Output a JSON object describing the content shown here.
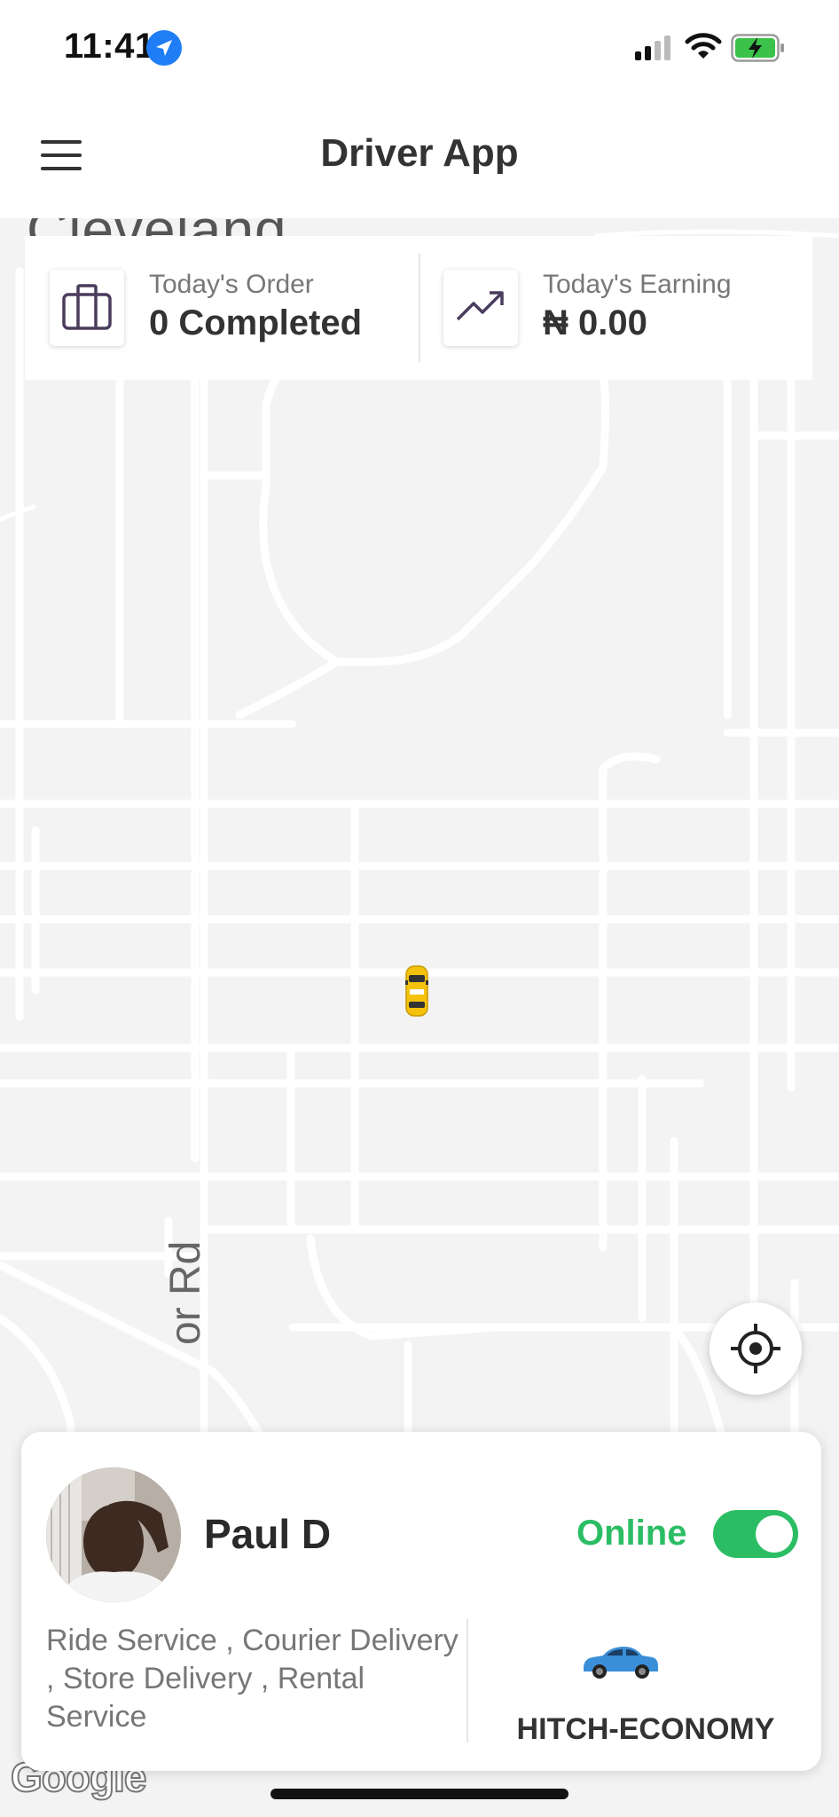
{
  "status_bar": {
    "time": "11:41",
    "icons": [
      "location-arrow-icon",
      "cellular-signal-icon",
      "wifi-icon",
      "battery-charging-icon"
    ]
  },
  "header": {
    "title": "Driver App",
    "menu_icon": "hamburger-menu-icon"
  },
  "map": {
    "city_label": "Cleveland",
    "road_label": "or Rd",
    "attribution": "Google",
    "marker_icon": "taxi-car-icon",
    "locate_icon": "crosshair-locate-icon"
  },
  "stats": {
    "order": {
      "icon": "briefcase-icon",
      "label": "Today's Order",
      "value": "0 Completed"
    },
    "earning": {
      "icon": "trending-up-icon",
      "label": "Today's Earning",
      "value": "₦ 0.00"
    }
  },
  "driver": {
    "name": "Paul D",
    "status": "Online",
    "online": true,
    "services": "Ride Service , Courier Delivery , Store Delivery , Rental Service",
    "vehicle_type": "HITCH-ECONOMY",
    "vehicle_icon": "car-icon"
  },
  "colors": {
    "accent_green": "#2bbd64",
    "location_blue": "#1f7ef5",
    "taxi_yellow": "#f4c20d",
    "map_background": "#f3f3f3",
    "map_road": "#ffffff"
  }
}
